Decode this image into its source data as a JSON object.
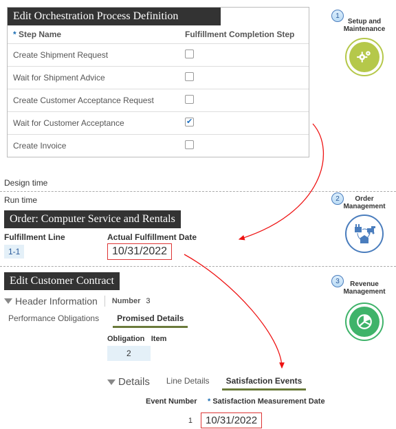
{
  "orchestration": {
    "title": "Edit Orchestration Process Definition",
    "columns": {
      "step_name": "Step Name",
      "fulfillment_step": "Fulfillment Completion Step"
    },
    "rows": [
      {
        "name": "Create Shipment Request",
        "checked": false
      },
      {
        "name": "Wait for Shipment Advice",
        "checked": false
      },
      {
        "name": "Create Customer Acceptance Request",
        "checked": false
      },
      {
        "name": "Wait for Customer Acceptance",
        "checked": true
      },
      {
        "name": "Create Invoice",
        "checked": false
      }
    ]
  },
  "phases": {
    "design_time": "Design time",
    "run_time": "Run time"
  },
  "steps": {
    "s1": {
      "num": "1",
      "label": "Setup and Maintenance"
    },
    "s2": {
      "num": "2",
      "label": "Order Management"
    },
    "s3": {
      "num": "3",
      "label": "Revenue Management"
    }
  },
  "order": {
    "title": "Order: Computer Service and Rentals",
    "fulfillment_line": {
      "header": "Fulfillment Line",
      "value": "1-1"
    },
    "actual_date": {
      "header": "Actual Fulfillment Date",
      "value": "10/31/2022"
    }
  },
  "contract": {
    "title": "Edit Customer Contract",
    "header_info": "Header Information",
    "number_label": "Number",
    "number_value": "3",
    "tabs1": {
      "perf": "Performance Obligations",
      "promised": "Promised Details"
    },
    "obligation": {
      "header": "Obligation",
      "item_header": "Item",
      "value": "2"
    },
    "details_label": "Details",
    "tabs2": {
      "line": "Line Details",
      "sat": "Satisfaction Events"
    },
    "events": {
      "col_event_num": "Event Number",
      "col_date": "Satisfaction Measurement Date",
      "row": {
        "num": "1",
        "date": "10/31/2022"
      }
    }
  }
}
